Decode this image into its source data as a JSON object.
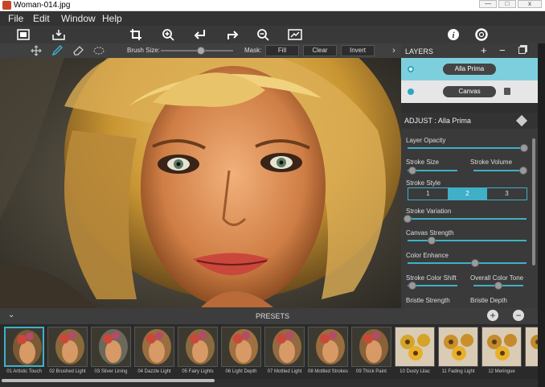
{
  "window": {
    "title": "Woman-014.jpg",
    "min": "—",
    "max": "□",
    "close": "x"
  },
  "menu": [
    "File",
    "Edit",
    "Window",
    "Help"
  ],
  "options": {
    "brush_size_label": "Brush Size:",
    "brush_size_value": 0.55,
    "mask_label": "Mask:",
    "fill": "Fill",
    "clear": "Clear",
    "invert": "Invert"
  },
  "layers": {
    "title": "LAYERS",
    "items": [
      {
        "name": "Alla Prima",
        "selected": true
      },
      {
        "name": "Canvas",
        "selected": false
      }
    ]
  },
  "adjust": {
    "title": "ADJUST : Alla Prima",
    "layer_opacity": "Layer Opacity",
    "stroke_size": "Stroke Size",
    "stroke_volume": "Stroke Volume",
    "stroke_style": "Stroke Style",
    "stroke_style_options": [
      "1",
      "2",
      "3"
    ],
    "stroke_style_selected": 2,
    "stroke_variation": "Stroke Variation",
    "canvas_strength": "Canvas Strength",
    "color_enhance": "Color Enhance",
    "stroke_color_shift": "Stroke Color Shift",
    "overall_color_tone": "Overall Color Tone",
    "bristle_strength": "Bristle Strength",
    "bristle_depth": "Bristle Depth",
    "values": {
      "layer_opacity": 1.0,
      "stroke_size": 0.1,
      "stroke_volume": 1.0,
      "stroke_variation": 0.0,
      "canvas_strength": 0.2,
      "color_enhance": 0.57,
      "stroke_color_shift": 0.1,
      "overall_color_tone": 0.5
    }
  },
  "presets": {
    "title": "PRESETS",
    "add": "+",
    "remove": "−",
    "items": [
      "01 Artistic Touch",
      "02 Brushed Light",
      "03 Silver Lining",
      "04 Dazzle Light",
      "05 Fairy Lights",
      "06 Light Depth",
      "07 Mottled Light",
      "08 Mottled Strokes",
      "09 Thick Paint",
      "10 Dusty Lilac",
      "11 Fading Light",
      "12 Meringue",
      "13 Li"
    ]
  },
  "colors": {
    "accent": "#3fb0c8",
    "selected_layer": "#7ecfdd"
  }
}
